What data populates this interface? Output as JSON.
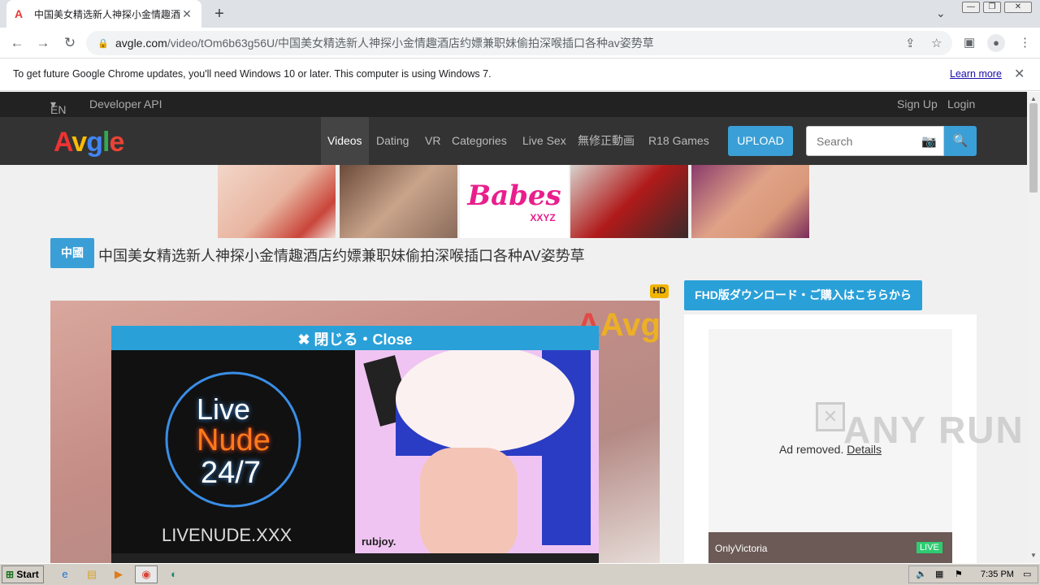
{
  "browser": {
    "tab_title": "中国美女精选新人神探小金情趣酒店",
    "tab_favicon": "A",
    "url_domain": "avgle.com",
    "url_path": "/video/tOm6b63g56U/中国美女精选新人神探小金情趣酒店约嫖兼职妹偷拍深喉插口各种av姿势草"
  },
  "infobar": {
    "message": "To get future Google Chrome updates, you'll need Windows 10 or later. This computer is using Windows 7.",
    "learn_more": "Learn more"
  },
  "site": {
    "lang": "EN",
    "developer_api": "Developer API",
    "sign_up": "Sign Up",
    "login": "Login",
    "logo": [
      "A",
      "v",
      "g",
      "l",
      "e"
    ],
    "nav": [
      "Videos",
      "Dating",
      "VR",
      "Categories",
      "Live Sex",
      "無修正動画",
      "R18 Games"
    ],
    "upload": "UPLOAD",
    "search_placeholder": "Search"
  },
  "ads": {
    "babes_text": "Babes",
    "babes_sub": "XXYZ"
  },
  "video": {
    "category_badge": "中國",
    "title": "中国美女精选新人神探小金情趣酒店约嫖兼职妹偷拍深喉插口各种AV姿势草",
    "hd_badge": "HD",
    "watermark": "Avgle"
  },
  "modal": {
    "close_label": "✖ 閉じる・Close",
    "left_ad": {
      "line1": "Live",
      "line2": "Nude",
      "line3": "24/7",
      "site": "LIVENUDE.XXX"
    },
    "right_ad": {
      "brand": "rubjoy."
    }
  },
  "sidebar": {
    "fhd_button": "FHD版ダウンロード・ご購入はこちらから",
    "ad_removed": "Ad removed.",
    "details": "Details",
    "live_name": "OnlyVictoria",
    "live_badge": "LIVE"
  },
  "watermark_text": "ANY RUN",
  "taskbar": {
    "start": "Start",
    "time": "7:35 PM"
  }
}
